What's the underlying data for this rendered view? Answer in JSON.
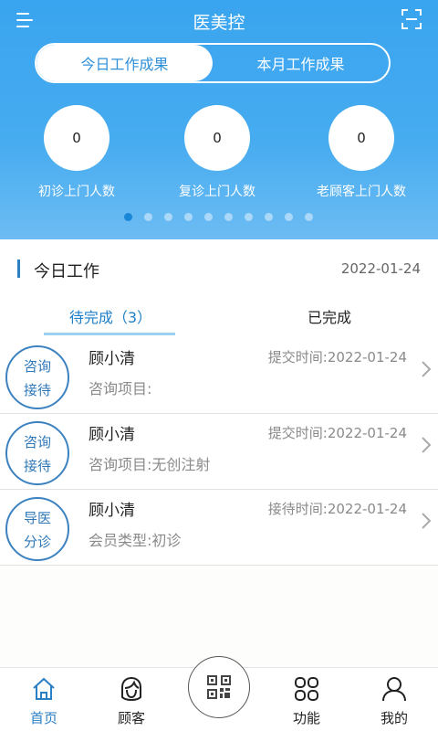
{
  "header": {
    "title": "医美控",
    "segments": {
      "today": "今日工作成果",
      "month": "本月工作成果",
      "selected": "today"
    },
    "stats": [
      {
        "value": "0",
        "label": "初诊上门人数"
      },
      {
        "value": "0",
        "label": "复诊上门人数"
      },
      {
        "value": "0",
        "label": "老顾客上门人数"
      }
    ],
    "pagination": {
      "total": 10,
      "current": 1
    }
  },
  "work": {
    "title": "今日工作",
    "date": "2022-01-24",
    "tabs": {
      "pending": "待完成（3）",
      "done": "已完成"
    }
  },
  "tasks": [
    {
      "badge_line1": "咨询",
      "badge_line2": "接待",
      "name": "顾小清",
      "time": "提交时间:2022-01-24",
      "detail": "咨询项目:"
    },
    {
      "badge_line1": "咨询",
      "badge_line2": "接待",
      "name": "顾小清",
      "time": "提交时间:2022-01-24",
      "detail": "咨询项目:无创注射"
    },
    {
      "badge_line1": "导医",
      "badge_line2": "分诊",
      "name": "顾小清",
      "time": "接待时间:2022-01-24",
      "detail": "会员类型:初诊"
    }
  ],
  "nav": {
    "home": "首页",
    "customers": "顾客",
    "functions": "功能",
    "mine": "我的"
  },
  "colors": {
    "header_blue": "#39a4ef",
    "accent": "#2b7fc4",
    "badge_blue": "#3d82c0"
  },
  "icons": {
    "menu": "menu-icon",
    "scan": "scan-icon",
    "home": "home-icon",
    "customer": "customer-icon",
    "qr": "qr-code-icon",
    "functions": "grid-icon",
    "mine": "user-icon",
    "chevron": "chevron-right-icon"
  }
}
